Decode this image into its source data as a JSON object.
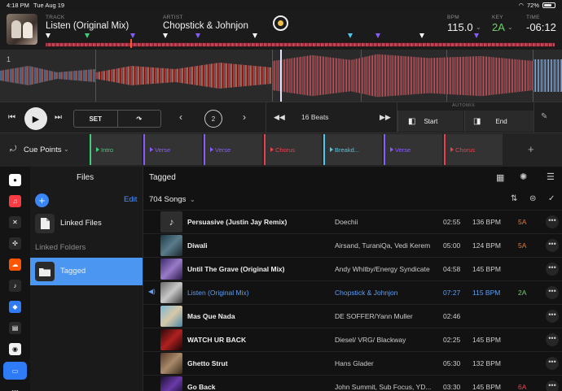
{
  "status_bar": {
    "time": "4:18 PM",
    "date": "Tue Aug 19",
    "battery": "72%",
    "battery_level": 0.72
  },
  "track": {
    "track_label": "TRACK",
    "title": "Listen (Original Mix)",
    "artist_label": "ARTIST",
    "artist": "Chopstick & Johnjon",
    "bpm_label": "BPM",
    "bpm": "115.0",
    "key_label": "KEY",
    "key": "2A",
    "time_label": "TIME",
    "time": "-06:12",
    "key_color": "#6fd06a",
    "overview_markers": [
      "#ffffff",
      "#3cd07a",
      "#8a5cff",
      "#ffffff",
      "#8a5cff",
      "#ffffff",
      "#4cc8e8",
      "#8a5cff",
      "#ffffff",
      "#8a5cff"
    ]
  },
  "waveform": {
    "beat_number": "1"
  },
  "transport": {
    "set_label": "SET",
    "loop_value": "2",
    "beats_label": "16 Beats",
    "automix_label": "AUTOMIX",
    "start_label": "Start",
    "end_label": "End"
  },
  "cues": {
    "label": "Cue Points",
    "items": [
      {
        "name": "Intro",
        "color": "#3cd07a"
      },
      {
        "name": "Verse",
        "color": "#8a5cff"
      },
      {
        "name": "Verse",
        "color": "#8a5cff"
      },
      {
        "name": "Chorus",
        "color": "#e8424f"
      },
      {
        "name": "Breakd...",
        "color": "#4cc8e8"
      },
      {
        "name": "Verse",
        "color": "#8a5cff"
      },
      {
        "name": "Chorus",
        "color": "#e8424f"
      }
    ]
  },
  "sidebar": {
    "icons": [
      "record-icon",
      "music-icon",
      "beatport-icon",
      "tidal-icon",
      "soundcloud-icon",
      "beatsource-icon",
      "dropbox-icon",
      "video-icon",
      "spotify-icon",
      "files-icon",
      "more-icon"
    ],
    "files_title": "Files",
    "edit_label": "Edit",
    "linked_files": "Linked Files",
    "linked_folders": "Linked Folders",
    "tagged": "Tagged"
  },
  "main": {
    "title": "Tagged",
    "count": "704 Songs",
    "songs": [
      {
        "title": "Persuasive (Justin Jay Remix)",
        "artist": "Doechii",
        "duration": "02:55",
        "bpm": "136 BPM",
        "key": "5A",
        "key_color": "#e27a3a"
      },
      {
        "title": "Diwali",
        "artist": "Airsand, TuraniQa, Vedi Kerem",
        "duration": "05:00",
        "bpm": "124 BPM",
        "key": "5A",
        "key_color": "#e27a3a"
      },
      {
        "title": "Until The Grave (Original Mix)",
        "artist": "Andy Whitby/Energy Syndicate",
        "duration": "04:58",
        "bpm": "145 BPM",
        "key": "",
        "key_color": ""
      },
      {
        "title": "Listen (Original Mix)",
        "artist": "Chopstick & Johnjon",
        "duration": "07:27",
        "bpm": "115 BPM",
        "key": "2A",
        "key_color": "#6fd06a"
      },
      {
        "title": "Mas Que Nada",
        "artist": "DE SOFFER/Yann Muller",
        "duration": "02:46",
        "bpm": "",
        "key": "",
        "key_color": ""
      },
      {
        "title": "WATCH UR BACK",
        "artist": "Diesel/ VRG/ Blackway",
        "duration": "02:25",
        "bpm": "145 BPM",
        "key": "",
        "key_color": ""
      },
      {
        "title": "Ghetto Strut",
        "artist": "Hans Glader",
        "duration": "05:30",
        "bpm": "132 BPM",
        "key": "",
        "key_color": ""
      },
      {
        "title": "Go Back",
        "artist": "John Summit, Sub Focus, YD...",
        "duration": "03:30",
        "bpm": "145 BPM",
        "key": "6A",
        "key_color": "#e8424f"
      }
    ]
  }
}
